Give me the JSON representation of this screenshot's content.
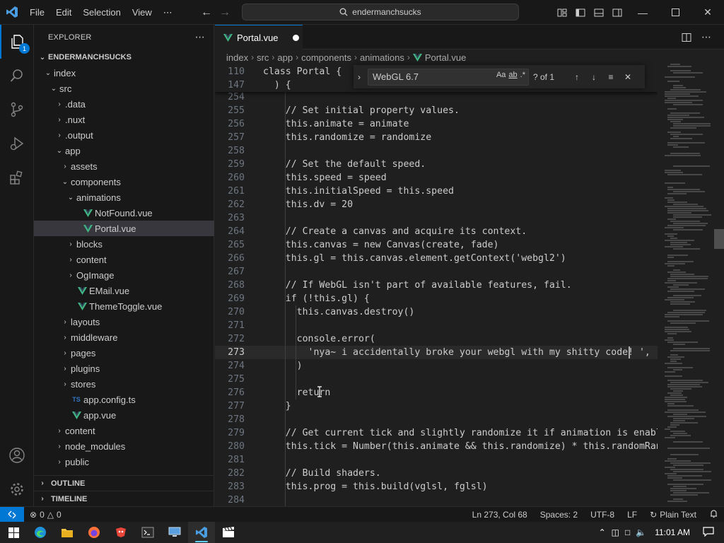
{
  "menu": [
    "File",
    "Edit",
    "Selection",
    "View",
    "⋯"
  ],
  "command_center": {
    "text": "endermanchsucks"
  },
  "activity_badge": "1",
  "sidebar": {
    "title": "EXPLORER",
    "more": "⋯",
    "tree": [
      {
        "label": "ENDERMANCHSUCKS",
        "depth": 0,
        "chevron": "⌄",
        "type": "root"
      },
      {
        "label": "index",
        "depth": 1,
        "chevron": "⌄",
        "type": "folder"
      },
      {
        "label": "src",
        "depth": 2,
        "chevron": "⌄",
        "type": "folder"
      },
      {
        "label": ".data",
        "depth": 3,
        "chevron": "›",
        "type": "folder"
      },
      {
        "label": ".nuxt",
        "depth": 3,
        "chevron": "›",
        "type": "folder"
      },
      {
        "label": ".output",
        "depth": 3,
        "chevron": "›",
        "type": "folder"
      },
      {
        "label": "app",
        "depth": 3,
        "chevron": "⌄",
        "type": "folder"
      },
      {
        "label": "assets",
        "depth": 4,
        "chevron": "›",
        "type": "folder"
      },
      {
        "label": "components",
        "depth": 4,
        "chevron": "⌄",
        "type": "folder"
      },
      {
        "label": "animations",
        "depth": 5,
        "chevron": "⌄",
        "type": "folder"
      },
      {
        "label": "NotFound.vue",
        "depth": 6,
        "chevron": "",
        "type": "vue"
      },
      {
        "label": "Portal.vue",
        "depth": 6,
        "chevron": "",
        "type": "vue",
        "selected": true
      },
      {
        "label": "blocks",
        "depth": 5,
        "chevron": "›",
        "type": "folder"
      },
      {
        "label": "content",
        "depth": 5,
        "chevron": "›",
        "type": "folder"
      },
      {
        "label": "OgImage",
        "depth": 5,
        "chevron": "›",
        "type": "folder"
      },
      {
        "label": "EMail.vue",
        "depth": 5,
        "chevron": "",
        "type": "vue"
      },
      {
        "label": "ThemeToggle.vue",
        "depth": 5,
        "chevron": "",
        "type": "vue"
      },
      {
        "label": "layouts",
        "depth": 4,
        "chevron": "›",
        "type": "folder"
      },
      {
        "label": "middleware",
        "depth": 4,
        "chevron": "›",
        "type": "folder"
      },
      {
        "label": "pages",
        "depth": 4,
        "chevron": "›",
        "type": "folder"
      },
      {
        "label": "plugins",
        "depth": 4,
        "chevron": "›",
        "type": "folder"
      },
      {
        "label": "stores",
        "depth": 4,
        "chevron": "›",
        "type": "folder"
      },
      {
        "label": "app.config.ts",
        "depth": 4,
        "chevron": "",
        "type": "ts"
      },
      {
        "label": "app.vue",
        "depth": 4,
        "chevron": "",
        "type": "vue"
      },
      {
        "label": "content",
        "depth": 3,
        "chevron": "›",
        "type": "folder"
      },
      {
        "label": "node_modules",
        "depth": 3,
        "chevron": "›",
        "type": "folder"
      },
      {
        "label": "public",
        "depth": 3,
        "chevron": "›",
        "type": "folder"
      }
    ],
    "sections": [
      "OUTLINE",
      "TIMELINE"
    ]
  },
  "tab": {
    "label": "Portal.vue"
  },
  "breadcrumb": [
    "index",
    "src",
    "app",
    "components",
    "animations",
    "Portal.vue"
  ],
  "find": {
    "query": "WebGL 6.7",
    "options": [
      "Aa",
      "ab",
      ".*"
    ],
    "count": "? of 1"
  },
  "editor": {
    "sticky": [
      {
        "num": "110",
        "code": "class Portal {"
      },
      {
        "num": "147",
        "code": "  ) {"
      }
    ],
    "lines": [
      {
        "num": "254",
        "code": ""
      },
      {
        "num": "255",
        "code": "    // Set initial property values."
      },
      {
        "num": "256",
        "code": "    this.animate = animate"
      },
      {
        "num": "257",
        "code": "    this.randomize = randomize"
      },
      {
        "num": "258",
        "code": ""
      },
      {
        "num": "259",
        "code": "    // Set the default speed."
      },
      {
        "num": "260",
        "code": "    this.speed = speed"
      },
      {
        "num": "261",
        "code": "    this.initialSpeed = this.speed"
      },
      {
        "num": "262",
        "code": "    this.dv = 20"
      },
      {
        "num": "263",
        "code": ""
      },
      {
        "num": "264",
        "code": "    // Create a canvas and acquire its context."
      },
      {
        "num": "265",
        "code": "    this.canvas = new Canvas(create, fade)"
      },
      {
        "num": "266",
        "code": "    this.gl = this.canvas.element.getContext('webgl2')"
      },
      {
        "num": "267",
        "code": ""
      },
      {
        "num": "268",
        "code": "    // If WebGL isn't part of available features, fail."
      },
      {
        "num": "269",
        "code": "    if (!this.gl) {"
      },
      {
        "num": "270",
        "code": "      this.canvas.destroy()"
      },
      {
        "num": "271",
        "code": ""
      },
      {
        "num": "272",
        "code": "      console.error("
      },
      {
        "num": "273",
        "code": "        'nya~ i accidentally broke your webgl with my shitty code! ',"
      },
      {
        "num": "274",
        "code": "      )"
      },
      {
        "num": "275",
        "code": ""
      },
      {
        "num": "276",
        "code": "      return"
      },
      {
        "num": "277",
        "code": "    }"
      },
      {
        "num": "278",
        "code": ""
      },
      {
        "num": "279",
        "code": "    // Get current tick and slightly randomize it if animation is enabled."
      },
      {
        "num": "280",
        "code": "    this.tick = Number(this.animate && this.randomize) * this.randomRange"
      },
      {
        "num": "281",
        "code": ""
      },
      {
        "num": "282",
        "code": "    // Build shaders."
      },
      {
        "num": "283",
        "code": "    this.prog = this.build(vglsl, fglsl)"
      },
      {
        "num": "284",
        "code": ""
      }
    ]
  },
  "status": {
    "errors": "0",
    "warnings": "0",
    "position": "Ln 273, Col 68",
    "spaces": "Spaces: 2",
    "encoding": "UTF-8",
    "eol": "LF",
    "language": "Plain Text"
  },
  "taskbar": {
    "time": "11:01 AM"
  },
  "colors": {
    "accent": "#0078d4",
    "vue_green": "#41b883",
    "ts_blue": "#3178c6",
    "editor_bg": "#1f1f1f",
    "chrome_bg": "#181818"
  }
}
